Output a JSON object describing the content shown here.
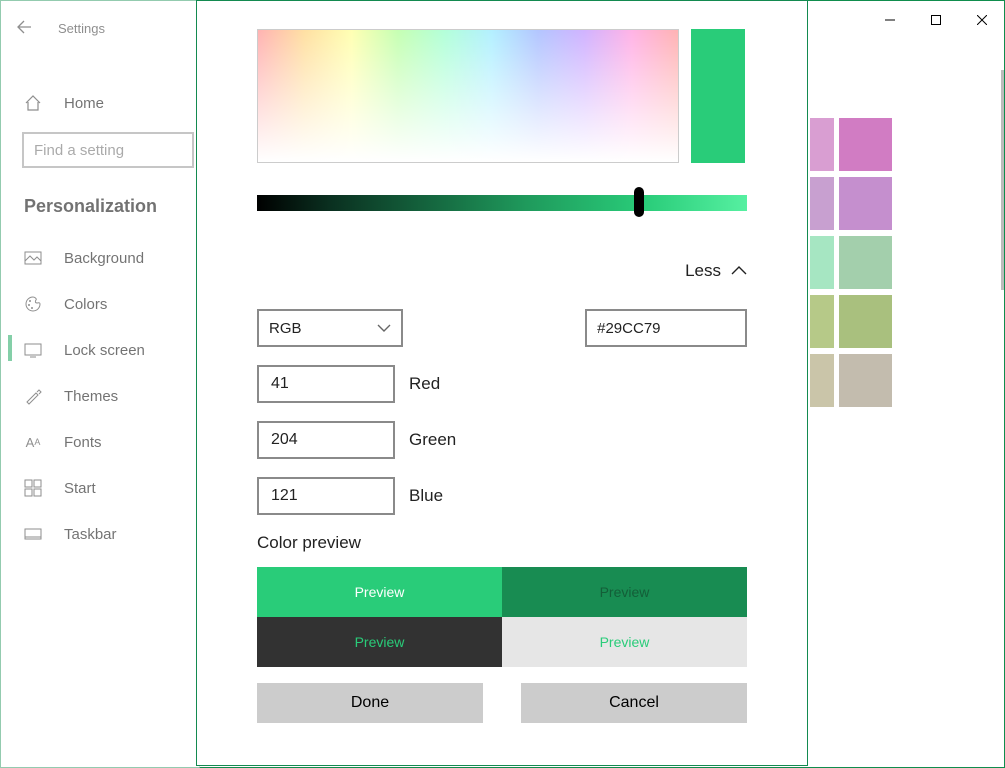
{
  "titlebar": {
    "minimize": "minimize",
    "maximize": "maximize",
    "close": "close"
  },
  "sidebar": {
    "app_title": "Settings",
    "search_placeholder": "Find a setting",
    "section": "Personalization",
    "items": [
      {
        "label": "Home",
        "icon": "home-icon"
      },
      {
        "label": "Background",
        "icon": "picture-icon"
      },
      {
        "label": "Colors",
        "icon": "palette-icon"
      },
      {
        "label": "Lock screen",
        "icon": "monitor-icon"
      },
      {
        "label": "Themes",
        "icon": "brush-icon"
      },
      {
        "label": "Fonts",
        "icon": "font-icon"
      },
      {
        "label": "Start",
        "icon": "start-icon"
      },
      {
        "label": "Taskbar",
        "icon": "taskbar-icon"
      }
    ],
    "active_index": 2
  },
  "palette_swatches_right": [
    "#d99ed2",
    "#c8a0d0",
    "#a6e6c2",
    "#b6c988",
    "#cac5a9"
  ],
  "palette_swatches_far_right": [
    "#d17cc3",
    "#c58fce",
    "#a3cfac",
    "#a9c07e",
    "#c3bcae"
  ],
  "picker": {
    "less_label": "Less",
    "color_model": "RGB",
    "hex_value": "#29CC79",
    "channels": {
      "red": {
        "label": "Red",
        "value": "41"
      },
      "green": {
        "label": "Green",
        "value": "204"
      },
      "blue": {
        "label": "Blue",
        "value": "121"
      }
    },
    "preview_title": "Color preview",
    "preview_label": "Preview",
    "preview_colors": {
      "bright": "#29CC79",
      "dark": "#188c52",
      "on_dark_bg": "#323232",
      "on_light_bg": "#e6e6e6"
    },
    "buttons": {
      "done": "Done",
      "cancel": "Cancel"
    }
  }
}
